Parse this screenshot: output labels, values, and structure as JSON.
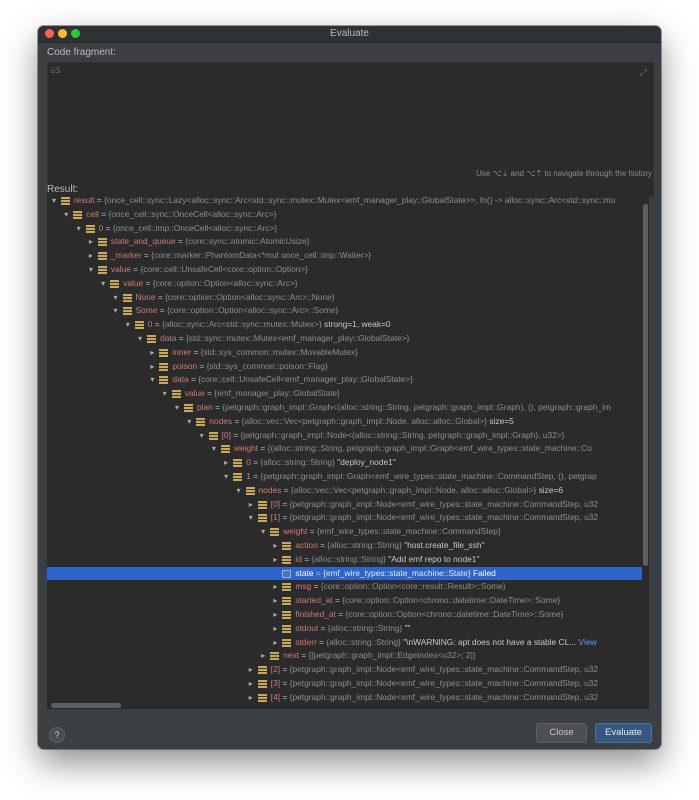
{
  "window": {
    "title": "Evaluate",
    "code_fragment_label": "Code fragment:",
    "code_placeholder": "GS",
    "history_hint": "Use ⌥⇣ and ⌥⇡ to navigate through the history",
    "result_label": "Result:"
  },
  "buttons": {
    "help": "?",
    "close": "Close",
    "evaluate": "Evaluate"
  },
  "colors": {
    "field_name": "#cc7a7a",
    "type_text": "#8e8e8e",
    "selection": "#2f65ca",
    "accent_button": "#365880"
  },
  "tree": [
    {
      "depth": 0,
      "toggle": "open",
      "icon": "field",
      "name": "result",
      "type": "{once_cell::sync::Lazy<alloc::sync::Arc<std::sync::mutex::Mutex<emf_manager_play::GlobalState>>, fn() -> alloc::sync::Arc<std::sync::mu"
    },
    {
      "depth": 1,
      "toggle": "open",
      "icon": "field",
      "name": "cell",
      "type": "{once_cell::sync::OnceCell<alloc::sync::Arc>}"
    },
    {
      "depth": 2,
      "toggle": "open",
      "icon": "field",
      "name": "0",
      "type": "{once_cell::imp::OnceCell<alloc::sync::Arc>}"
    },
    {
      "depth": 3,
      "toggle": "closed",
      "icon": "field",
      "name": "state_and_queue",
      "type": "{core::sync::atomic::AtomicUsize}"
    },
    {
      "depth": 3,
      "toggle": "closed",
      "icon": "field",
      "name": "_marker",
      "type": "{core::marker::PhantomData<*mut once_cell::imp::Waiter>}"
    },
    {
      "depth": 3,
      "toggle": "open",
      "icon": "field",
      "name": "value",
      "type": "{core::cell::UnsafeCell<core::option::Option>}"
    },
    {
      "depth": 4,
      "toggle": "open",
      "icon": "field",
      "name": "value",
      "type": "{core::option::Option<alloc::sync::Arc>}"
    },
    {
      "depth": 5,
      "toggle": "open",
      "icon": "field",
      "name": "None",
      "type": "{core::option::Option<alloc::sync::Arc>::None}"
    },
    {
      "depth": 5,
      "toggle": "open",
      "icon": "field",
      "name": "Some",
      "type": "{core::option::Option<alloc::sync::Arc>::Some}"
    },
    {
      "depth": 6,
      "toggle": "open",
      "icon": "field",
      "name": "0",
      "type": "{alloc::sync::Arc<std::sync::mutex::Mutex>}",
      "value": "strong=1, weak=0"
    },
    {
      "depth": 7,
      "toggle": "open",
      "icon": "field",
      "name": "data",
      "type": "{std::sync::mutex::Mutex<emf_manager_play::GlobalState>}"
    },
    {
      "depth": 8,
      "toggle": "closed",
      "icon": "field",
      "name": "inner",
      "type": "{std::sys_common::mutex::MovableMutex}"
    },
    {
      "depth": 8,
      "toggle": "closed",
      "icon": "field",
      "name": "poison",
      "type": "{std::sys_common::poison::Flag}"
    },
    {
      "depth": 8,
      "toggle": "open",
      "icon": "field",
      "name": "data",
      "type": "{core::cell::UnsafeCell<emf_manager_play::GlobalState>}"
    },
    {
      "depth": 9,
      "toggle": "open",
      "icon": "field",
      "name": "value",
      "type": "{emf_manager_play::GlobalState}"
    },
    {
      "depth": 10,
      "toggle": "open",
      "icon": "field",
      "name": "plan",
      "type": "{petgraph::graph_impl::Graph<(alloc::string::String, petgraph::graph_impl::Graph), (), petgraph::graph_im"
    },
    {
      "depth": 11,
      "toggle": "open",
      "icon": "field",
      "name": "nodes",
      "type": "{alloc::vec::Vec<petgraph::graph_impl::Node, alloc::alloc::Global>}",
      "value": "size=5"
    },
    {
      "depth": 12,
      "toggle": "open",
      "icon": "field",
      "name": "[0]",
      "type": "{petgraph::graph_impl::Node<(alloc::string::String, petgraph::graph_impl::Graph), u32>}"
    },
    {
      "depth": 13,
      "toggle": "open",
      "icon": "field",
      "name": "weight",
      "type": "{(alloc::string::String, petgraph::graph_impl::Graph<emf_wire_types::state_machine::Co"
    },
    {
      "depth": 14,
      "toggle": "closed",
      "icon": "field",
      "name": "0",
      "type": "{alloc::string::String}",
      "value": "\"deploy_node1\""
    },
    {
      "depth": 14,
      "toggle": "open",
      "icon": "field",
      "name": "1",
      "type": "{petgraph::graph_impl::Graph<emf_wire_types::state_machine::CommandStep, (), petgrap"
    },
    {
      "depth": 15,
      "toggle": "open",
      "icon": "field",
      "name": "nodes",
      "type": "{alloc::vec::Vec<petgraph::graph_impl::Node, alloc::alloc::Global>}",
      "value": "size=6"
    },
    {
      "depth": 16,
      "toggle": "closed",
      "icon": "field",
      "name": "[0]",
      "type": "{petgraph::graph_impl::Node<emf_wire_types::state_machine::CommandStep, u32"
    },
    {
      "depth": 16,
      "toggle": "open",
      "icon": "field",
      "name": "[1]",
      "type": "{petgraph::graph_impl::Node<emf_wire_types::state_machine::CommandStep, u32"
    },
    {
      "depth": 17,
      "toggle": "open",
      "icon": "field",
      "name": "weight",
      "type": "{emf_wire_types::state_machine::CommandStep}"
    },
    {
      "depth": 18,
      "toggle": "closed",
      "icon": "field",
      "name": "action",
      "type": "{alloc::string::String}",
      "value": "\"host.create_file_ssh\""
    },
    {
      "depth": 18,
      "toggle": "closed",
      "icon": "field",
      "name": "id",
      "type": "{alloc::string::String}",
      "value": "\"Add emf repo to node1\""
    },
    {
      "depth": 18,
      "toggle": "none",
      "icon": "prim",
      "name": "state",
      "type": "{emf_wire_types::state_machine::State}",
      "value": "Failed",
      "selected": true
    },
    {
      "depth": 18,
      "toggle": "closed",
      "icon": "field",
      "name": "msg",
      "type": "{core::option::Option<core::result::Result>::Some}"
    },
    {
      "depth": 18,
      "toggle": "closed",
      "icon": "field",
      "name": "started_at",
      "type": "{core::option::Option<chrono::datetime::DateTime>::Some}"
    },
    {
      "depth": 18,
      "toggle": "closed",
      "icon": "field",
      "name": "finished_at",
      "type": "{core::option::Option<chrono::datetime::DateTime>::Some}"
    },
    {
      "depth": 18,
      "toggle": "closed",
      "icon": "field",
      "name": "stdout",
      "type": "{alloc::string::String}",
      "value": "\"\""
    },
    {
      "depth": 18,
      "toggle": "closed",
      "icon": "field",
      "name": "stderr",
      "type": "{alloc::string::String}",
      "value": "\"\\nWARNING: apt does not have a stable CL...",
      "escape": "\\n",
      "link": "View"
    },
    {
      "depth": 17,
      "toggle": "closed",
      "icon": "field",
      "name": "next",
      "type": "{[petgraph::graph_impl::EdgeIndex<u32>; 2]}"
    },
    {
      "depth": 16,
      "toggle": "closed",
      "icon": "field",
      "name": "[2]",
      "type": "{petgraph::graph_impl::Node<emf_wire_types::state_machine::CommandStep, u32"
    },
    {
      "depth": 16,
      "toggle": "closed",
      "icon": "field",
      "name": "[3]",
      "type": "{petgraph::graph_impl::Node<emf_wire_types::state_machine::CommandStep, u32"
    },
    {
      "depth": 16,
      "toggle": "closed",
      "icon": "field",
      "name": "[4]",
      "type": "{petgraph::graph_impl::Node<emf_wire_types::state_machine::CommandStep, u32"
    }
  ]
}
